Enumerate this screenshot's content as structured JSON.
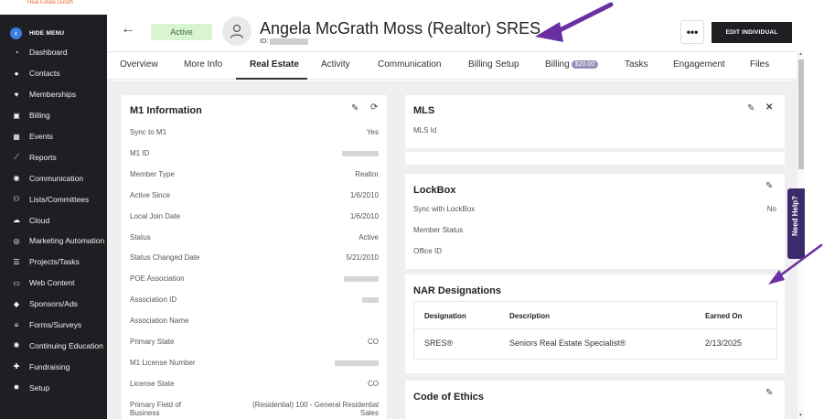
{
  "sidebar": {
    "top_text": "Heal Estate Duluth",
    "hide_menu": "HIDE MENU",
    "items": [
      {
        "label": "Dashboard",
        "icon": "dashboard-icon"
      },
      {
        "label": "Contacts",
        "icon": "person-icon"
      },
      {
        "label": "Memberships",
        "icon": "heart-icon"
      },
      {
        "label": "Billing",
        "icon": "money-icon"
      },
      {
        "label": "Events",
        "icon": "calendar-icon"
      },
      {
        "label": "Reports",
        "icon": "chart-icon"
      },
      {
        "label": "Communication",
        "icon": "chat-icon"
      },
      {
        "label": "Lists/Committees",
        "icon": "group-icon"
      },
      {
        "label": "Cloud",
        "icon": "cloud-icon"
      },
      {
        "label": "Marketing Automation",
        "icon": "target-icon"
      },
      {
        "label": "Projects/Tasks",
        "icon": "checklist-icon"
      },
      {
        "label": "Web Content",
        "icon": "monitor-icon"
      },
      {
        "label": "Sponsors/Ads",
        "icon": "diamond-icon"
      },
      {
        "label": "Forms/Surveys",
        "icon": "list-icon"
      },
      {
        "label": "Continuing Education",
        "icon": "gear-icon"
      },
      {
        "label": "Fundraising",
        "icon": "gift-icon"
      },
      {
        "label": "Setup",
        "icon": "cog-icon"
      }
    ]
  },
  "header": {
    "status": "Active",
    "name": "Angela McGrath Moss (Realtor) SRES",
    "id_prefix": "ID:",
    "more": "•••",
    "edit_button": "EDIT INDIVIDUAL"
  },
  "tabs": [
    {
      "label": "Overview"
    },
    {
      "label": "More Info"
    },
    {
      "label": "Real Estate",
      "active": true
    },
    {
      "label": "Activity"
    },
    {
      "label": "Communication"
    },
    {
      "label": "Billing Setup"
    },
    {
      "label": "Billing",
      "badge": "$20.00"
    },
    {
      "label": "Tasks"
    },
    {
      "label": "Engagement"
    },
    {
      "label": "Files"
    }
  ],
  "m1": {
    "title": "M1 Information",
    "rows": [
      {
        "label": "Sync to M1",
        "value": "Yes"
      },
      {
        "label": "M1 ID",
        "value": ""
      },
      {
        "label": "Member Type",
        "value": "Realtor"
      },
      {
        "label": "Active Since",
        "value": "1/6/2010"
      },
      {
        "label": "Local Join Date",
        "value": "1/6/2010"
      },
      {
        "label": "Status",
        "value": "Active"
      },
      {
        "label": "Status Changed Date",
        "value": "5/21/2010"
      },
      {
        "label": "POE Association",
        "value": ""
      },
      {
        "label": "Association ID",
        "value": ""
      },
      {
        "label": "Association Name",
        "value": ""
      },
      {
        "label": "Primary State",
        "value": "CO"
      },
      {
        "label": "M1 License Number",
        "value": ""
      },
      {
        "label": "License State",
        "value": "CO"
      },
      {
        "label": "Primary Field of Business",
        "value": "(Residential) 100 - General Residential Sales"
      }
    ]
  },
  "mls": {
    "title": "MLS",
    "field": "MLS Id"
  },
  "lockbox": {
    "title": "LockBox",
    "rows": [
      {
        "label": "Sync with LockBox",
        "value": "No"
      },
      {
        "label": "Member Status",
        "value": ""
      },
      {
        "label": "Office ID",
        "value": ""
      }
    ]
  },
  "nar": {
    "title": "NAR Designations",
    "headers": [
      "Designation",
      "Description",
      "Earned On"
    ],
    "rows": [
      {
        "designation": "SRES®",
        "description": "Seniors Real Estate Specialist®",
        "earned_on": "2/13/2025"
      }
    ]
  },
  "ethics": {
    "title": "Code of Ethics"
  },
  "help": {
    "label": "Need Help?"
  },
  "colors": {
    "sidebar_bg": "#1d1f23",
    "accent": "#3b7ddd",
    "badge_green": "#d8f4d0",
    "annotation_arrow": "#6a2fa0",
    "help_bg": "#3d2a6b"
  }
}
